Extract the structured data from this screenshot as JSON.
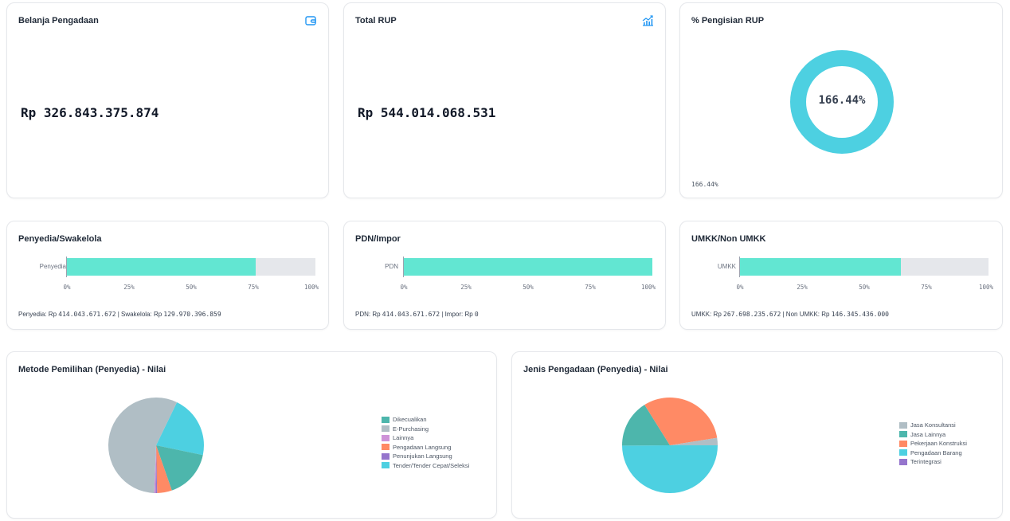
{
  "cards": {
    "belanja": {
      "title": "Belanja Pengadaan",
      "value": "Rp 326.843.375.874",
      "icon": "wallet-icon"
    },
    "rup": {
      "title": "Total RUP",
      "value": "Rp 544.014.068.531",
      "icon": "chart-growth-icon"
    },
    "pengisian": {
      "title": "% Pengisian RUP",
      "donut_label": "166.44%",
      "note": "166.44%",
      "percent": 166.44,
      "color": "#4dd0e1"
    }
  },
  "bars": {
    "swakelola": {
      "title": "Penyedia/Swakelola",
      "label": "Penyedia",
      "fraction": 0.761,
      "ticks": [
        "0%",
        "25%",
        "50%",
        "75%",
        "100%"
      ],
      "note_prefix": "Penyedia: Rp ",
      "note_val1": "414.043.671.672",
      "note_mid": " | Swakelola: Rp ",
      "note_val2": "129.970.396.859"
    },
    "pdn": {
      "title": "PDN/Impor",
      "label": "PDN",
      "fraction": 1.0,
      "ticks": [
        "0%",
        "25%",
        "50%",
        "75%",
        "100%"
      ],
      "note_prefix": "PDN: Rp ",
      "note_val1": "414.043.671.672",
      "note_mid": " | Impor: Rp ",
      "note_val2": "0"
    },
    "umkk": {
      "title": "UMKK/Non UMKK",
      "label": "UMKK",
      "fraction": 0.647,
      "ticks": [
        "0%",
        "25%",
        "50%",
        "75%",
        "100%"
      ],
      "note_prefix": "UMKK: Rp ",
      "note_val1": "267.698.235.672",
      "note_mid": " | Non UMKK: Rp ",
      "note_val2": "146.345.436.000"
    }
  },
  "chart_data": [
    {
      "type": "pie",
      "title": "Metode Pemilihan (Penyedia) - Nilai",
      "categories": [
        "Dikecualikan",
        "E-Purchasing",
        "Lainnya",
        "Pengadaan Langsung",
        "Penunjukan Langsung",
        "Tender/Tender Cepat/Seleksi"
      ],
      "values": [
        16.4,
        56.5,
        0.5,
        5.0,
        0.5,
        21.1
      ],
      "colors": [
        "#4db6ac",
        "#b0bec5",
        "#ce93d8",
        "#ff8a65",
        "#9575cd",
        "#4dd0e1"
      ],
      "legend": "right"
    },
    {
      "type": "pie",
      "title": "Jenis Pengadaan (Penyedia) - Nilai",
      "categories": [
        "Jasa Konsultansi",
        "Jasa Lainnya",
        "Pekerjaan Konstruksi",
        "Pengadaan Barang",
        "Terintegrasi"
      ],
      "values": [
        2.5,
        16.2,
        31.4,
        49.9,
        0.0
      ],
      "colors": [
        "#b0bec5",
        "#4db6ac",
        "#ff8a65",
        "#4dd0e1",
        "#9575cd"
      ],
      "legend": "right"
    }
  ]
}
